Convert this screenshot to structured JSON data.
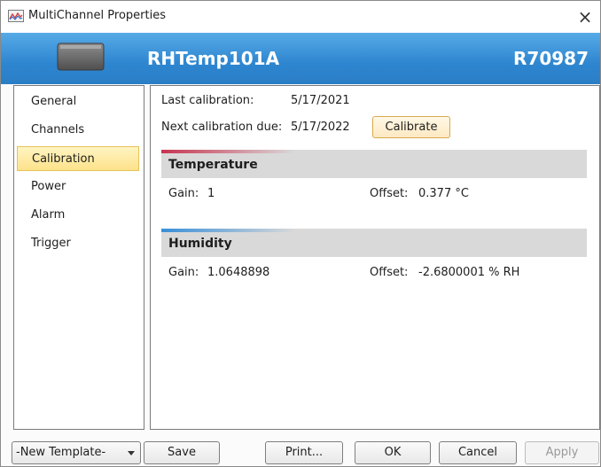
{
  "window": {
    "title": "MultiChannel Properties",
    "close_glyph": "×"
  },
  "banner": {
    "device_name": "RHTemp101A",
    "serial": "R70987",
    "device_icon": "logger-device-icon"
  },
  "sidebar": {
    "items": [
      {
        "label": "General"
      },
      {
        "label": "Channels"
      },
      {
        "label": "Calibration",
        "selected": true
      },
      {
        "label": "Power"
      },
      {
        "label": "Alarm"
      },
      {
        "label": "Trigger"
      }
    ]
  },
  "calibration": {
    "last_label": "Last calibration:",
    "last_value": "5/17/2021",
    "next_label": "Next calibration due:",
    "next_value": "5/17/2022",
    "calibrate_button": "Calibrate",
    "sections": [
      {
        "title": "Temperature",
        "gain_label": "Gain:",
        "gain_value": "1",
        "offset_label": "Offset:",
        "offset_value": "0.377 °C",
        "accent_color": "#c8344f"
      },
      {
        "title": "Humidity",
        "gain_label": "Gain:",
        "gain_value": "1.0648898",
        "offset_label": "Offset:",
        "offset_value": "-2.6800001 % RH",
        "accent_color": "#3a8fd8"
      }
    ]
  },
  "footer": {
    "template_select": "-New Template-",
    "save": "Save",
    "print": "Print...",
    "ok": "OK",
    "cancel": "Cancel",
    "apply": "Apply",
    "apply_enabled": false
  },
  "colors": {
    "banner": "#3a90d6",
    "selected_item": "#fde28a",
    "section_bg": "#d9d9d9"
  }
}
